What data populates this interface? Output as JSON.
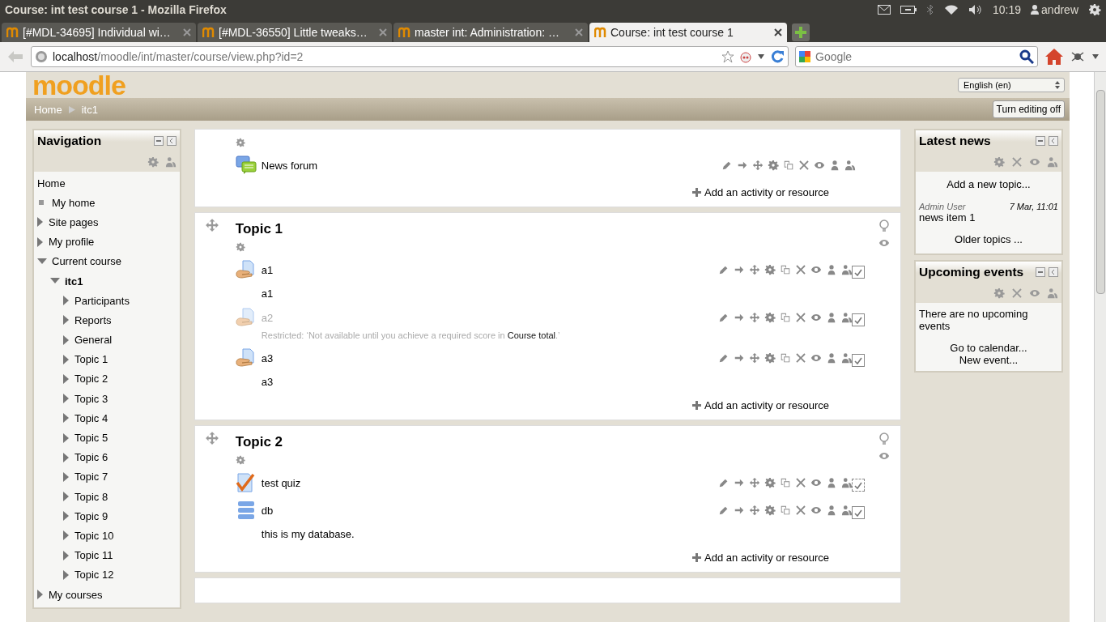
{
  "window": {
    "title": "Course: int test course 1 - Mozilla Firefox"
  },
  "panel": {
    "time": "10:19",
    "user": "andrew"
  },
  "tabs": [
    {
      "label": "[#MDL-34695] Individual wi…",
      "selected": false
    },
    {
      "label": "[#MDL-36550] Little tweaks…",
      "selected": false
    },
    {
      "label": "master int: Administration: …",
      "selected": false
    },
    {
      "label": "Course: int test course 1",
      "selected": true
    }
  ],
  "url": {
    "host": "localhost",
    "path": "/moodle/int/master/course/view.php?id=2"
  },
  "search": {
    "placeholder": "Google"
  },
  "header": {
    "logo": "moodle",
    "language": "English (en)"
  },
  "breadcrumb": [
    {
      "label": "Home"
    },
    {
      "label": "itc1"
    }
  ],
  "edit_button": "Turn editing off",
  "navigation": {
    "title": "Navigation",
    "items": [
      {
        "label": "Home",
        "kind": "plain"
      },
      {
        "label": "My home",
        "kind": "bullet"
      },
      {
        "label": "Site pages",
        "kind": "branch",
        "expanded": false
      },
      {
        "label": "My profile",
        "kind": "branch",
        "expanded": false
      },
      {
        "label": "Current course",
        "kind": "branch",
        "expanded": true,
        "children": [
          {
            "label": "itc1",
            "kind": "branch",
            "expanded": true,
            "current": true,
            "children": [
              {
                "label": "Participants",
                "kind": "branch",
                "expanded": false
              },
              {
                "label": "Reports",
                "kind": "branch",
                "expanded": false
              },
              {
                "label": "General",
                "kind": "branch",
                "expanded": false
              },
              {
                "label": "Topic 1",
                "kind": "branch",
                "expanded": false
              },
              {
                "label": "Topic 2",
                "kind": "branch",
                "expanded": false
              },
              {
                "label": "Topic 3",
                "kind": "branch",
                "expanded": false
              },
              {
                "label": "Topic 4",
                "kind": "branch",
                "expanded": false
              },
              {
                "label": "Topic 5",
                "kind": "branch",
                "expanded": false
              },
              {
                "label": "Topic 6",
                "kind": "branch",
                "expanded": false
              },
              {
                "label": "Topic 7",
                "kind": "branch",
                "expanded": false
              },
              {
                "label": "Topic 8",
                "kind": "branch",
                "expanded": false
              },
              {
                "label": "Topic 9",
                "kind": "branch",
                "expanded": false
              },
              {
                "label": "Topic 10",
                "kind": "branch",
                "expanded": false
              },
              {
                "label": "Topic 11",
                "kind": "branch",
                "expanded": false
              },
              {
                "label": "Topic 12",
                "kind": "branch",
                "expanded": false
              }
            ]
          }
        ]
      },
      {
        "label": "My courses",
        "kind": "branch",
        "expanded": false
      }
    ]
  },
  "sections": [
    {
      "add_link": "Add an activity or resource",
      "activities": [
        {
          "name": "News forum",
          "kind": "forum",
          "dimmed": false
        }
      ]
    },
    {
      "title": "Topic 1",
      "add_link": "Add an activity or resource",
      "activities": [
        {
          "name": "a1",
          "kind": "assignment",
          "dimmed": false,
          "description": "a1",
          "completion": {
            "kind": "manual",
            "checked": true
          }
        },
        {
          "name": "a2",
          "kind": "assignment",
          "dimmed": true,
          "restriction": "Restricted: ‘Not available until you achieve a required score in ",
          "restriction_link": "Course total",
          "restriction_end": ".’",
          "completion": {
            "kind": "manual",
            "checked": true
          }
        },
        {
          "name": "a3",
          "kind": "assignment",
          "dimmed": false,
          "description": "a3",
          "completion": {
            "kind": "manual",
            "checked": true
          }
        }
      ]
    },
    {
      "title": "Topic 2",
      "add_link": "Add an activity or resource",
      "activities": [
        {
          "name": "test quiz",
          "kind": "quiz",
          "dimmed": false,
          "completion": {
            "kind": "auto",
            "checked": true
          }
        },
        {
          "name": "db",
          "kind": "database",
          "dimmed": false,
          "description": "this is my database.",
          "completion": {
            "kind": "manual",
            "checked": true
          }
        }
      ]
    }
  ],
  "latest_news": {
    "title": "Latest news",
    "add": "Add a new topic...",
    "posts": [
      {
        "author": "Admin User",
        "date": "7 Mar, 11:01",
        "subject": "news item 1"
      }
    ],
    "older": "Older topics ..."
  },
  "upcoming": {
    "title": "Upcoming events",
    "text": "There are no upcoming events",
    "links": [
      "Go to calendar...",
      "New event..."
    ]
  }
}
